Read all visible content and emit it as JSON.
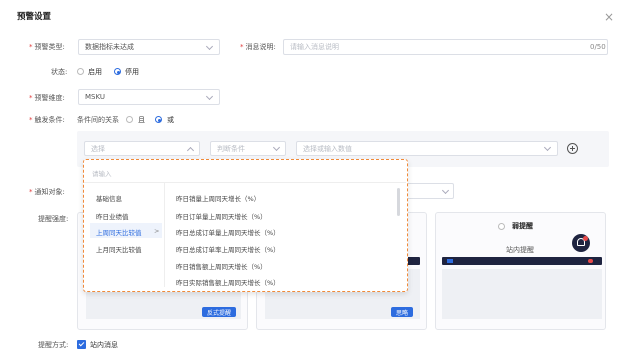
{
  "dialog": {
    "title": "预警设置",
    "close": "×"
  },
  "form": {
    "type": {
      "label": "预警类型:",
      "value": "数据指标未达成"
    },
    "message": {
      "label": "消息说明:",
      "placeholder": "请输入消息说明",
      "counter": "0/50"
    },
    "status": {
      "label": "状态:",
      "options": [
        "启用",
        "停用"
      ],
      "selected": "停用"
    },
    "dimension": {
      "label": "预警维度:",
      "value": "MSKU"
    },
    "trigger": {
      "label": "触发条件:",
      "relation_label": "条件间的关系",
      "options": [
        "且",
        "或"
      ],
      "selected": "或"
    },
    "condition_row": {
      "select1": "选择",
      "select2": "判断条件",
      "select3": "选择或输入数值"
    },
    "notify": {
      "label": "通知对象:"
    },
    "strength": {
      "label": "提醒强度:"
    },
    "method": {
      "label": "提醒方式:",
      "checkbox_label": "站内消息",
      "checked": true
    }
  },
  "popup": {
    "search_placeholder": "请输入",
    "left_items": [
      "基础信息",
      "昨日业绩值",
      "上周同天比较值",
      "上月同天比较值"
    ],
    "left_selected": "上周同天比较值",
    "arrow": ">",
    "right_items": [
      "昨日销量上周同天增长（%）",
      "昨日订单量上周同天增长（%）",
      "昨日总成订单量上周同天增长（%）",
      "昨日总成订单率上周同天增长（%）",
      "昨日销售额上周同天增长（%）",
      "昨日实际销售额上周同天增长（%）"
    ]
  },
  "cards": {
    "card1": {
      "button": "反式提醒"
    },
    "card2": {
      "button": "思略"
    },
    "card3": {
      "title": "弱提醒",
      "subtitle": "站内提醒"
    }
  },
  "colors": {
    "accent": "#2d6cdf",
    "required": "#e03a3a",
    "popup_border": "#f08a3a",
    "dark_bar": "#1f2440"
  }
}
